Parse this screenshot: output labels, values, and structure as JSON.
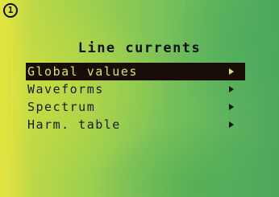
{
  "screen": {
    "badge": "1",
    "title": "Line currents"
  },
  "menu": {
    "items": [
      {
        "label": "Global values",
        "selected": true
      },
      {
        "label": "Waveforms",
        "selected": false
      },
      {
        "label": "Spectrum",
        "selected": false
      },
      {
        "label": "Harm. table",
        "selected": false
      }
    ],
    "arrow_icon": "triangle-right-icon"
  },
  "colors": {
    "screen_green": "#7ec458",
    "selection_bg": "#1a0d08",
    "selection_text": "#d6e36a",
    "text": "#1a1a1a"
  }
}
